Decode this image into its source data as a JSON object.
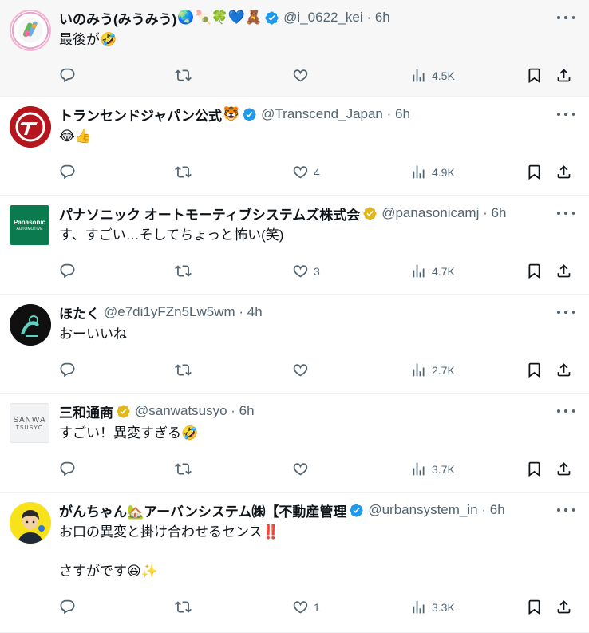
{
  "tweets": [
    {
      "name": "いのみう(みうみう)",
      "emoji": "🌏🍡🍀💙🧸",
      "handle": "@i_0622_kei",
      "time": "6h",
      "text": "最後が🤣",
      "replies": "",
      "retweets": "",
      "likes": "",
      "views": "4.5K",
      "badge": "blue",
      "highlight": true
    },
    {
      "name": "トランセンドジャパン公式",
      "emoji": "🐯",
      "handle": "@Transcend_Japan",
      "time": "6h",
      "text": "😂👍",
      "replies": "",
      "retweets": "",
      "likes": "4",
      "views": "4.9K",
      "badge": "blue"
    },
    {
      "name": "パナソニック オートモーティブシステムズ株式会",
      "emoji": "",
      "handle": "@panasonicamj",
      "time": "6h",
      "text": "す、すごい…そしてちょっと怖い(笑)",
      "replies": "",
      "retweets": "",
      "likes": "3",
      "views": "4.7K",
      "badge": "gold",
      "avatar_text": "Panasonic",
      "avatar_sub": "AUTOMOTIVE"
    },
    {
      "name": "ほたく",
      "emoji": "",
      "handle": "@e7di1yFZn5Lw5wm",
      "time": "4h",
      "text": "おーいいね",
      "replies": "",
      "retweets": "",
      "likes": "",
      "views": "2.7K",
      "badge": "none"
    },
    {
      "name": "三和通商",
      "emoji": "",
      "handle": "@sanwatsusyo",
      "time": "6h",
      "text": "すごい！異変すぎる🤣",
      "replies": "",
      "retweets": "",
      "likes": "",
      "views": "3.7K",
      "badge": "gold",
      "avatar_text": "SANWA",
      "avatar_sub": "TSUSYO"
    },
    {
      "name": "がんちゃん🏡アーバンシステム㈱【不動産管理",
      "emoji": "",
      "handle": "@urbansystem_in",
      "time": "6h",
      "text": "お口の異変と掛け合わせるセンス‼️",
      "text2": "さすがです😆✨",
      "replies": "",
      "retweets": "",
      "likes": "1",
      "views": "3.3K",
      "badge": "blue"
    }
  ],
  "separator": "·",
  "colors": {
    "muted": "#536471",
    "blue_badge": "#1d9bf0",
    "gold_badge": "#e2b719",
    "divider": "#eff3f4"
  },
  "icons": [
    "reply-icon",
    "retweet-icon",
    "like-icon",
    "views-icon",
    "bookmark-icon",
    "share-icon",
    "more-icon",
    "verified-badge-icon"
  ]
}
